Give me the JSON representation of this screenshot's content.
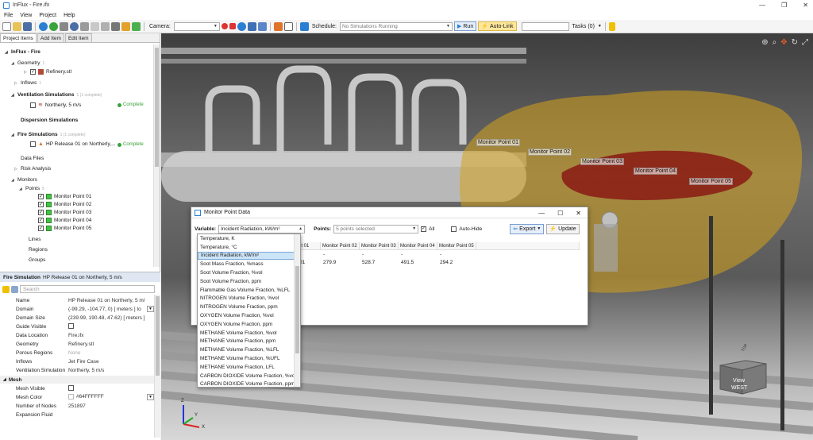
{
  "window": {
    "title": "InFlux - Fire.ifx",
    "controls": [
      "—",
      "❐",
      "✕"
    ]
  },
  "menu": [
    "File",
    "View",
    "Project",
    "Help"
  ],
  "toolbar": {
    "camera_label": "Camera:",
    "camera_value": "",
    "schedule_label": "Schedule:",
    "schedule_value": "No Simulations Running",
    "run_label": "Run",
    "autolink_label": "Auto-Link",
    "search_value": "",
    "tasks_label": "Tasks (0)"
  },
  "left": {
    "tabs": [
      "Project Items",
      "Add Item",
      "Edit Item"
    ],
    "tree": {
      "root": "InFlux - Fire",
      "geometry": "Geometry",
      "geometry_count": "1",
      "refinery": "Refinery.stl",
      "inflows": "Inflows",
      "inflows_count": "1",
      "ventilation": "Ventilation Simulations",
      "ventilation_count": "1 (1 complete)",
      "northerly": "Northerly, 5 m/s",
      "complete1": "Complete",
      "dispersion": "Dispersion Simulations",
      "fire": "Fire Simulations",
      "fire_count": "1 (1 complete)",
      "hp_release": "HP Release 01 on Northerly,...",
      "complete2": "Complete",
      "data_files": "Data Files",
      "risk": "Risk Analysis",
      "monitors": "Monitors",
      "points": "Points",
      "points_count": "5",
      "mp": [
        "Monitor Point 01",
        "Monitor Point 02",
        "Monitor Point 03",
        "Monitor Point 04",
        "Monitor Point 05"
      ],
      "lines": "Lines",
      "regions": "Regions",
      "groups": "Groups"
    },
    "props": {
      "header_type": "Fire Simulation",
      "header_name": "HP Release 01 on Northerly, 5 m/s",
      "search_placeholder": "Search",
      "rows": [
        {
          "name": "Name",
          "value": "HP Release 01 on Northerly, 5 m/"
        },
        {
          "name": "Domain",
          "value": "(-99.29, -104.77, 0) [ meters ] to"
        },
        {
          "name": "Domain Size",
          "value": "(239.99, 190.48, 47.62) [ meters ]"
        },
        {
          "name": "Guide Visible",
          "value": ""
        },
        {
          "name": "Data Location",
          "value": "Fire.ifx"
        },
        {
          "name": "Geometry",
          "value": "Refinery.stl"
        },
        {
          "name": "Porous Regions",
          "value": "None"
        },
        {
          "name": "Inflows",
          "value": "Jet Fire Case"
        },
        {
          "name": "Ventilation Simulation",
          "value": "Northerly, 5 m/s"
        }
      ],
      "mesh_category": "Mesh",
      "mesh_rows": [
        {
          "name": "Mesh Visible",
          "value": ""
        },
        {
          "name": "Mesh Color",
          "value": "#64FFFFFF"
        },
        {
          "name": "Number of Nodes",
          "value": "251897"
        },
        {
          "name": "Expansion Fluid",
          "value": ""
        }
      ]
    }
  },
  "viewport": {
    "monitor_labels": [
      "Monitor Point 01",
      "Monitor Point 02",
      "Monitor Point 03",
      "Monitor Point 04",
      "Monitor Point 05"
    ],
    "navcube_view": "View",
    "navcube_dir": "WEST",
    "navcube_top": "TOP",
    "axis_z": "Z",
    "axis_x": "X",
    "axis_y": "Y"
  },
  "dialog": {
    "title": "Monitor Point Data",
    "variable_label": "Variable:",
    "variable_value": "Incident Radiation, kW/m²",
    "points_label": "Points:",
    "points_value": "5 points selected",
    "all_label": "All",
    "autohide_label": "Auto-Hide",
    "export_label": "Export",
    "update_label": "Update",
    "columns": [
      "Monitor Point 01",
      "Monitor Point 02",
      "Monitor Point 03",
      "Monitor Point 04",
      "Monitor Point 05"
    ],
    "row_leading": "01",
    "values": [
      "",
      "279.9",
      "528.7",
      "491.5",
      "294.2"
    ],
    "row_dashes": [
      "-",
      "-",
      "-",
      "-"
    ]
  },
  "variable_options": [
    "Temperature, K",
    "Temperature, °C",
    "Incident Radiation, kW/m²",
    "Soot Mass Fraction, %mass",
    "Soot Volume Fraction, %vol",
    "Soot Volume Fraction, ppm",
    "Flammable Gas Volume Fraction, %LFL",
    "NITROGEN Volume Fraction, %vol",
    "NITROGEN Volume Fraction, ppm",
    "OXYGEN Volume Fraction, %vol",
    "OXYGEN Volume Fraction, ppm",
    "METHANE Volume Fraction, %vol",
    "METHANE Volume Fraction, ppm",
    "METHANE Volume Fraction, %LFL",
    "METHANE Volume Fraction, %UFL",
    "METHANE Volume Fraction, LFL",
    "CARBON DIOXIDE Volume Fraction, %vol",
    "CARBON DIOXIDE Volume Fraction, ppm"
  ],
  "colors": {
    "plume": "#d4a21c",
    "flame": "#8a1a14",
    "accent": "#2a7fd4"
  }
}
